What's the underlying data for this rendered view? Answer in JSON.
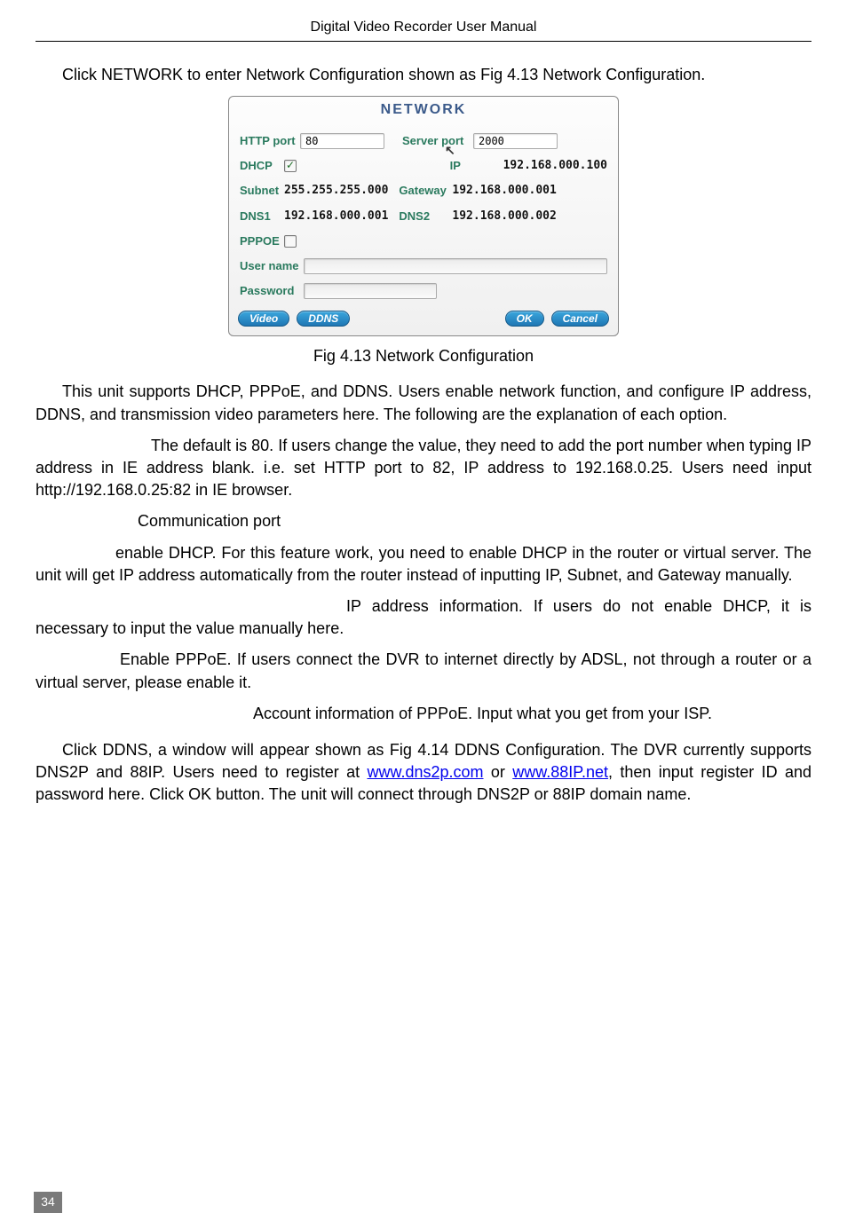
{
  "header": {
    "title": "Digital Video Recorder User Manual"
  },
  "intro": "Click NETWORK to enter Network Configuration shown as Fig 4.13   Network Configuration.",
  "dialog": {
    "title": "NETWORK",
    "http_port_label": "HTTP port",
    "http_port_value": "80",
    "server_port_label": "Server port",
    "server_port_value": "2000",
    "dhcp_label": "DHCP",
    "dhcp_checked": true,
    "ip_label": "IP",
    "ip_value": "192.168.000.100",
    "subnet_label": "Subnet",
    "subnet_value": "255.255.255.000",
    "gateway_label": "Gateway",
    "gateway_value": "192.168.000.001",
    "dns1_label": "DNS1",
    "dns1_value": "192.168.000.001",
    "dns2_label": "DNS2",
    "dns2_value": "192.168.000.002",
    "pppoe_label": "PPPOE",
    "pppoe_checked": false,
    "username_label": "User name",
    "password_label": "Password",
    "buttons": {
      "video": "Video",
      "ddns": "DDNS",
      "ok": "OK",
      "cancel": "Cancel"
    }
  },
  "fig_caption": "Fig 4.13   Network Configuration",
  "p1": "This unit supports DHCP, PPPoE, and DDNS. Users enable network function, and configure IP address, DDNS, and transmission video parameters here. The following are the explanation of each option.",
  "p2": "The default is 80. If users change the value, they need to add the port number when typing IP address in IE address blank. i.e. set HTTP port to 82, IP address to 192.168.0.25. Users need input http://192.168.0.25:82 in IE browser.",
  "p3": "Communication port",
  "p4": "enable DHCP. For this feature work, you need to enable DHCP in the router or virtual server. The unit will get IP address automatically from the router instead of inputting IP, Subnet, and Gateway manually.",
  "p5": "IP address information. If users do not enable DHCP, it is necessary to input the value manually here.",
  "p6": "Enable PPPoE. If users connect the DVR to internet directly by ADSL, not through a router or a virtual server, please enable it.",
  "p7": "Account information of PPPoE. Input what you get from your ISP.",
  "p8a": "Click DDNS, a window will appear shown as Fig 4.14 DDNS Configuration. The DVR currently supports DNS2P and 88IP. Users need to register at ",
  "link1": "www.dns2p.com",
  "p8b": " or ",
  "link2": "www.88IP.net",
  "p8c": ", then input register ID and password here. Click OK button. The unit will connect through DNS2P or 88IP domain name.",
  "page_number": "34"
}
